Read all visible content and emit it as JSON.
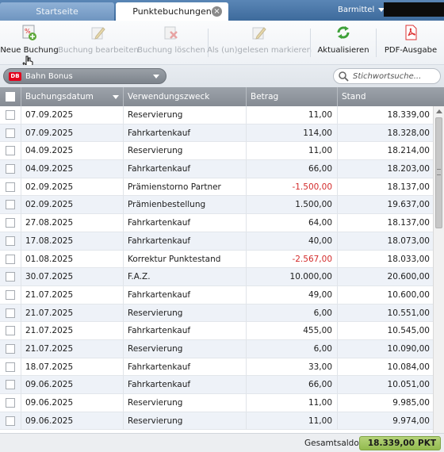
{
  "tabs": {
    "startseite": "Startseite",
    "punktebuchungen": "Punktebuchungen",
    "close_glyph": "×"
  },
  "header": {
    "barmittel_label": "Barmittel"
  },
  "toolbar": {
    "new_booking": "Neue Buchung",
    "edit_booking": "Buchung bearbeiten",
    "delete_booking": "Buchung löschen",
    "mark_read": "Als (un)gelesen markieren",
    "refresh": "Aktualisieren",
    "pdf_export": "PDF-Ausgabe"
  },
  "filter": {
    "account_logo": "DB",
    "account_name": "Bahn Bonus",
    "search_placeholder": "Stichwortsuche..."
  },
  "table": {
    "columns": {
      "date": "Buchungsdatum",
      "purpose": "Verwendungszweck",
      "amount": "Betrag",
      "balance": "Stand"
    },
    "rows": [
      {
        "date": "07.09.2025",
        "purpose": "Reservierung",
        "amount": "11,00",
        "balance": "18.339,00",
        "negative": false
      },
      {
        "date": "07.09.2025",
        "purpose": "Fahrkartenkauf",
        "amount": "114,00",
        "balance": "18.328,00",
        "negative": false
      },
      {
        "date": "04.09.2025",
        "purpose": "Reservierung",
        "amount": "11,00",
        "balance": "18.214,00",
        "negative": false
      },
      {
        "date": "04.09.2025",
        "purpose": "Fahrkartenkauf",
        "amount": "66,00",
        "balance": "18.203,00",
        "negative": false
      },
      {
        "date": "02.09.2025",
        "purpose": "Prämienstorno Partner",
        "amount": "-1.500,00",
        "balance": "18.137,00",
        "negative": true
      },
      {
        "date": "02.09.2025",
        "purpose": "Prämienbestellung",
        "amount": "1.500,00",
        "balance": "19.637,00",
        "negative": false
      },
      {
        "date": "27.08.2025",
        "purpose": "Fahrkartenkauf",
        "amount": "64,00",
        "balance": "18.137,00",
        "negative": false
      },
      {
        "date": "17.08.2025",
        "purpose": "Fahrkartenkauf",
        "amount": "40,00",
        "balance": "18.073,00",
        "negative": false
      },
      {
        "date": "01.08.2025",
        "purpose": "Korrektur Punktestand",
        "amount": "-2.567,00",
        "balance": "18.033,00",
        "negative": true
      },
      {
        "date": "30.07.2025",
        "purpose": "F.A.Z.",
        "amount": "10.000,00",
        "balance": "20.600,00",
        "negative": false
      },
      {
        "date": "21.07.2025",
        "purpose": "Fahrkartenkauf",
        "amount": "49,00",
        "balance": "10.600,00",
        "negative": false
      },
      {
        "date": "21.07.2025",
        "purpose": "Reservierung",
        "amount": "6,00",
        "balance": "10.551,00",
        "negative": false
      },
      {
        "date": "21.07.2025",
        "purpose": "Fahrkartenkauf",
        "amount": "455,00",
        "balance": "10.545,00",
        "negative": false
      },
      {
        "date": "21.07.2025",
        "purpose": "Reservierung",
        "amount": "6,00",
        "balance": "10.090,00",
        "negative": false
      },
      {
        "date": "18.07.2025",
        "purpose": "Fahrkartenkauf",
        "amount": "33,00",
        "balance": "10.084,00",
        "negative": false
      },
      {
        "date": "09.06.2025",
        "purpose": "Fahrkartenkauf",
        "amount": "66,00",
        "balance": "10.051,00",
        "negative": false
      },
      {
        "date": "09.06.2025",
        "purpose": "Reservierung",
        "amount": "11,00",
        "balance": "9.985,00",
        "negative": false
      },
      {
        "date": "09.06.2025",
        "purpose": "Reservierung",
        "amount": "11,00",
        "balance": "9.974,00",
        "negative": false
      }
    ]
  },
  "footer": {
    "total_label": "Gesamtsaldo",
    "total_value": "18.339,00",
    "total_unit": "PKT"
  },
  "colors": {
    "tabbar": "#3d6a9c",
    "negative_amount": "#d32b2b",
    "total_badge": "#93bb4f",
    "header_row": "#858b93",
    "alt_row": "#eef2f8"
  },
  "icons": [
    "new-booking-icon",
    "edit-booking-icon",
    "delete-booking-icon",
    "mark-read-icon",
    "refresh-icon",
    "pdf-icon",
    "search-icon",
    "db-logo-icon",
    "mouse-cursor-icon"
  ]
}
